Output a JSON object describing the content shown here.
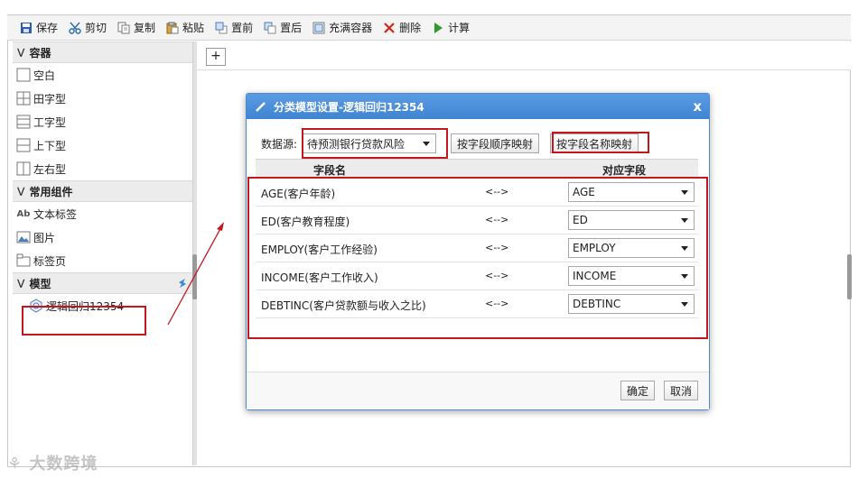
{
  "toolbar": {
    "buttons": [
      {
        "label": "保存",
        "icon": "save-icon"
      },
      {
        "label": "剪切",
        "icon": "scissors-icon"
      },
      {
        "label": "复制",
        "icon": "copy-icon"
      },
      {
        "label": "粘贴",
        "icon": "paste-icon"
      },
      {
        "label": "置前",
        "icon": "bring-front-icon"
      },
      {
        "label": "置后",
        "icon": "send-back-icon"
      },
      {
        "label": "充满容器",
        "icon": "fill-container-icon"
      },
      {
        "label": "删除",
        "icon": "delete-icon"
      },
      {
        "label": "计算",
        "icon": "play-icon"
      }
    ]
  },
  "sidebar": {
    "sections": [
      {
        "title": "容器",
        "items": [
          "空白",
          "田字型",
          "工字型",
          "上下型",
          "左右型"
        ]
      },
      {
        "title": "常用组件",
        "items": [
          "文本标签",
          "图片",
          "标签页"
        ]
      },
      {
        "title": "模型",
        "items": [
          "逻辑回归12354"
        ]
      }
    ],
    "text_label_icon_text": "Ab"
  },
  "canvas": {
    "add_button": "+"
  },
  "dialog": {
    "title": "分类模型设置-逻辑回归12354",
    "close": "x",
    "datasource_label": "数据源:",
    "datasource_value": "待预测银行贷款风险",
    "map_by_order": "按字段顺序映射",
    "map_by_name": "按字段名称映射",
    "col_field": "字段名",
    "col_mapped": "对应字段",
    "arrow": "<-->",
    "rows": [
      {
        "field": "AGE(客户年龄)",
        "mapped": "AGE"
      },
      {
        "field": "ED(客户教育程度)",
        "mapped": "ED"
      },
      {
        "field": "EMPLOY(客户工作经验)",
        "mapped": "EMPLOY"
      },
      {
        "field": "INCOME(客户工作收入)",
        "mapped": "INCOME"
      },
      {
        "field": "DEBTINC(客户贷款额与收入之比)",
        "mapped": "DEBTINC"
      }
    ],
    "ok": "确定",
    "cancel": "取消"
  },
  "watermark": "大数跨境",
  "colors": {
    "accent": "#3f84d2",
    "annotation_red": "#c4161c"
  }
}
